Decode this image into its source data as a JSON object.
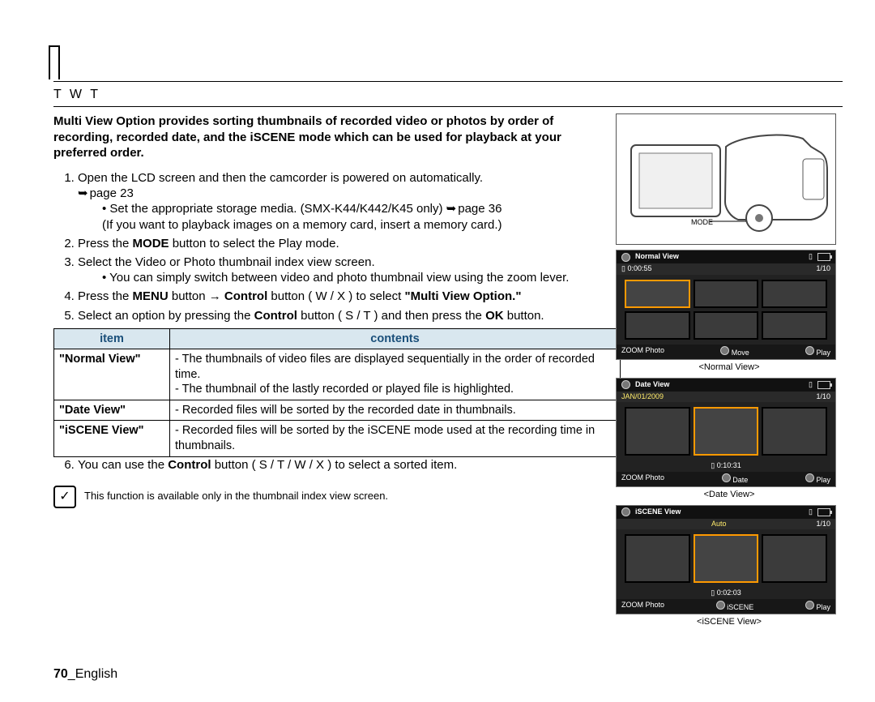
{
  "section_title": "T W T",
  "intro": "Multi View Option provides sorting thumbnails of recorded video or photos by order of recording, recorded date, and the iSCENE mode which can be used for playback at your preferred order.",
  "steps": {
    "s1": "Open the LCD screen and then the camcorder is powered on automatically.",
    "s1_ref": "page 23",
    "s1_b1": "Set the appropriate storage media. (SMX-K44/K442/K45 only) ",
    "s1_b1_suffix": "page 36",
    "s1_b1_paren": "(If you want to playback images on a memory card, insert a memory card.)",
    "s2_a": "Press the ",
    "s2_b": "MODE",
    "s2_c": " button to select the Play mode.",
    "s3": "Select the Video or Photo thumbnail index view screen.",
    "s3_b1": "You can simply switch between video and photo thumbnail view using the zoom lever.",
    "s4_a": "Press the ",
    "s4_b": "MENU",
    "s4_c": " button → ",
    "s4_d": "Control",
    "s4_e": " button ( W / X ) to select ",
    "s4_f": "\"Multi View Option.\"",
    "s5_a": "Select an option by pressing the ",
    "s5_b": "Control",
    "s5_c": " button ( S / T ) and then press the ",
    "s5_d": "OK",
    "s5_e": " button.",
    "s6_a": "You can use the ",
    "s6_b": "Control",
    "s6_c": " button ( S / T / W / X ) to select a sorted item."
  },
  "table": {
    "head_item": "item",
    "head_contents": "contents",
    "rows": [
      {
        "item": "\"Normal View\"",
        "contents": "- The thumbnails of video files are displayed sequentially in the order of recorded time.\n- The thumbnail of the lastly recorded or played file is highlighted."
      },
      {
        "item": "\"Date View\"",
        "contents": "- Recorded files will be sorted by the recorded date in thumbnails."
      },
      {
        "item": "\"iSCENE View\"",
        "contents": "- Recorded files will be sorted by the iSCENE mode used at the recording time in thumbnails."
      }
    ]
  },
  "note_icon": "✓",
  "note": "This function is available only in the thumbnail index view screen.",
  "footer_page": "70",
  "footer_lang": "_English",
  "side": {
    "mode_label": "MODE",
    "normal": {
      "title": "Normal View",
      "sub_left": "0:00:55",
      "sub_right": "1/10",
      "foot_l": "ZOOM Photo",
      "foot_m": "Move",
      "foot_r": "Play",
      "caption": "<Normal View>"
    },
    "date": {
      "title": "Date View",
      "sub_left": "JAN/01/2009",
      "sub_right": "1/10",
      "meta": "0:10:31",
      "foot_l": "ZOOM Photo",
      "foot_m": "Date",
      "foot_r": "Play",
      "caption": "<Date View>"
    },
    "iscene": {
      "title": "iSCENE View",
      "sub_left": "Auto",
      "sub_right": "1/10",
      "meta": "0:02:03",
      "foot_l": "ZOOM Photo",
      "foot_m": "iSCENE",
      "foot_r": "Play",
      "caption": "<iSCENE View>"
    }
  }
}
